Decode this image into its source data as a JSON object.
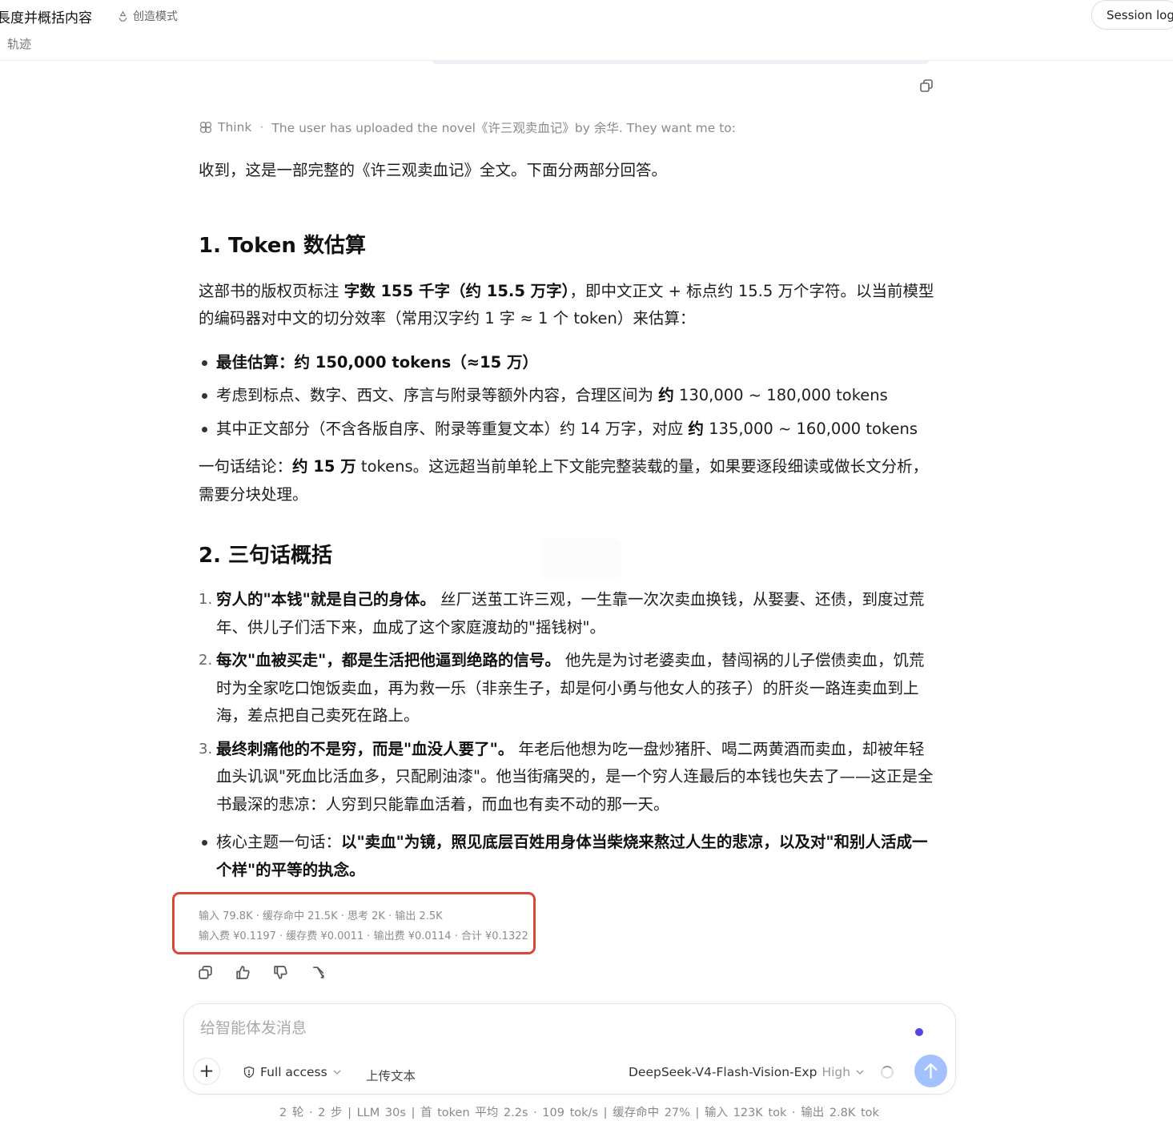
{
  "header": {
    "title": "長度并概括内容",
    "mode_label": "创造模式",
    "subnav": "轨迹",
    "session_button": "Session log"
  },
  "think": {
    "label": "Think",
    "separator": "·",
    "summary": "The user has uploaded the novel《许三观卖血记》by 余华. They want me to:"
  },
  "message": {
    "intro": "收到，这是一部完整的《许三观卖血记》全文。下面分两部分回答。",
    "section1": {
      "heading": "1. Token 数估算",
      "para_a": "这部书的版权页标注 ",
      "para_bold": "字数 155 千字（约 15.5 万字）",
      "para_b": "，即中文正文 + 标点约 15.5 万个字符。以当前模型的编码器对中文的切分效率（常用汉字约 1 字 ≈ 1 个 token）来估算：",
      "bullet1": "最佳估算：约 150,000 tokens（≈15 万）",
      "bullet2_a": "考虑到标点、数字、西文、序言与附录等额外内容，合理区间为 ",
      "bullet2_bold": "约",
      "bullet2_b": " 130,000 ~ 180,000 tokens",
      "bullet3_a": "其中正文部分（不含各版自序、附录等重复文本）约 14 万字，对应 ",
      "bullet3_bold": "约",
      "bullet3_b": " 135,000 ~ 160,000 tokens",
      "conclusion_a": "一句话结论：",
      "conclusion_bold": "约 15 万",
      "conclusion_b": " tokens。这远超当前单轮上下文能完整装载的量，如果要逐段细读或做长文分析，需要分块处理。"
    },
    "section2": {
      "heading": "2. 三句话概括",
      "items": [
        {
          "num": "1.",
          "bold": "穷人的\"本钱\"就是自己的身体。",
          "text": " 丝厂送茧工许三观，一生靠一次次卖血换钱，从娶妻、还债，到度过荒年、供儿子们活下来，血成了这个家庭渡劫的\"摇钱树\"。"
        },
        {
          "num": "2.",
          "bold": "每次\"血被买走\"，都是生活把他逼到绝路的信号。",
          "text": " 他先是为讨老婆卖血，替闯祸的儿子偿债卖血，饥荒时为全家吃口饱饭卖血，再为救一乐（非亲生子，却是何小勇与他女人的孩子）的肝炎一路连卖血到上海，差点把自己卖死在路上。"
        },
        {
          "num": "3.",
          "bold": "最终刺痛他的不是穷，而是\"血没人要了\"。",
          "text": " 年老后他想为吃一盘炒猪肝、喝二两黄酒而卖血，却被年轻血头讥讽\"死血比活血多，只配刷油漆\"。他当街痛哭的，是一个穷人连最后的本钱也失去了——这正是全书最深的悲凉：人穷到只能靠血活着，而血也有卖不动的那一天。"
        }
      ],
      "theme_a": "核心主题一句话：",
      "theme_bold": "以\"卖血\"为镜，照见底层百姓用身体当柴烧来熬过人生的悲凉，以及对\"和别人活成一个样\"的平等的执念。"
    }
  },
  "stats": {
    "line1": "输入 79.8K · 缓存命中 21.5K · 思考 2K · 输出 2.5K",
    "line2": "输入费 ¥0.1197 · 缓存费 ¥0.0011 · 输出费 ¥0.0114 · 合计 ¥0.1322",
    "highlight_color": "#d9473a"
  },
  "actions": [
    "copy-icon",
    "thumbs-up-icon",
    "thumbs-down-icon",
    "branch-icon"
  ],
  "composer": {
    "placeholder": "给智能体发消息",
    "access_label": "Full access",
    "upload_label": "上传文本",
    "model_name": "DeepSeek-V4-Flash-Vision-Exp",
    "model_level": "High",
    "accent_color": "#5543e8",
    "send_color": "#a3c0ff"
  },
  "footer": {
    "text": "2 轮 · 2 步  |  LLM 30s  |  首 token 平均 2.2s · 109 tok/s  |  缓存命中 27%  |  输入 123K tok · 输出 2.8K tok"
  }
}
